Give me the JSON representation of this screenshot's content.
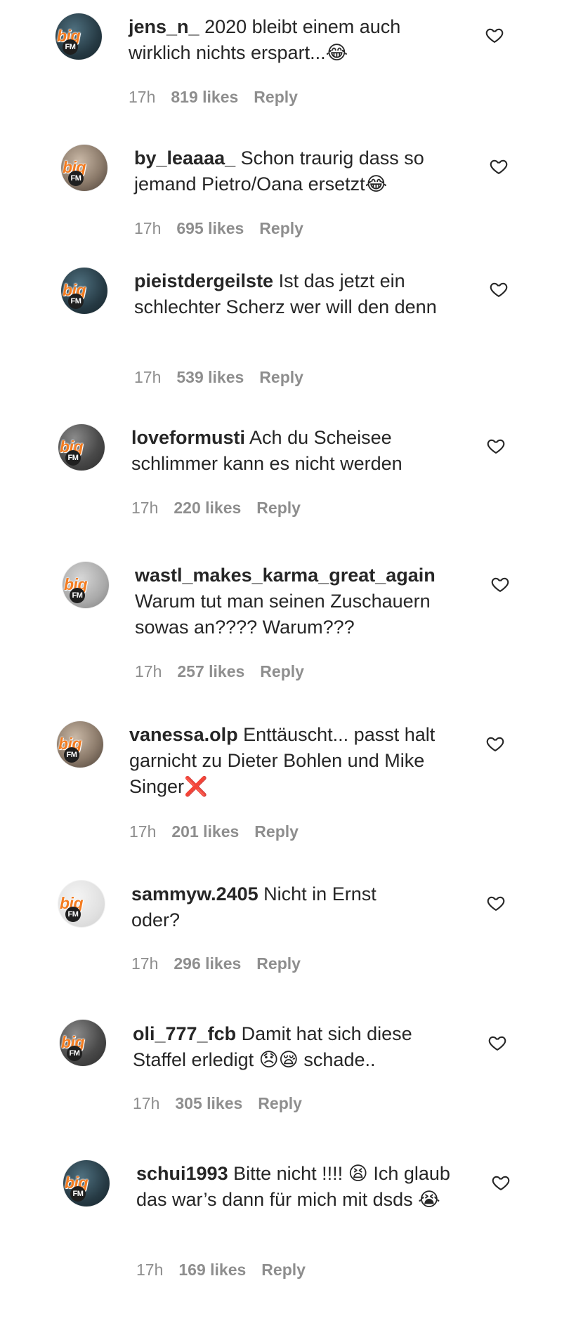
{
  "comments": [
    {
      "username": "jens_n_",
      "text": "2020 bleibt einem auch wirklich nichts erspart...😂",
      "time": "17h",
      "likes": "819 likes",
      "reply": "Reply",
      "avatar_logo": "big",
      "avatar_badge": "FM"
    },
    {
      "username": "by_leaaaa_",
      "text": "Schon traurig dass so jemand Pietro/Oana ersetzt😂",
      "time": "17h",
      "likes": "695 likes",
      "reply": "Reply",
      "avatar_logo": "big",
      "avatar_badge": "FM"
    },
    {
      "username": "pieistdergeilste",
      "text": "Ist das jetzt ein schlechter Scherz wer will den denn",
      "time": "17h",
      "likes": "539 likes",
      "reply": "Reply",
      "avatar_logo": "big",
      "avatar_badge": "FM"
    },
    {
      "username": "loveformusti",
      "text": "Ach du Scheisee schlimmer kann es nicht werden",
      "time": "17h",
      "likes": "220 likes",
      "reply": "Reply",
      "avatar_logo": "big",
      "avatar_badge": "FM"
    },
    {
      "username": "wastl_makes_karma_great_again",
      "text": "Warum tut man seinen Zuschauern sowas an???? Warum???",
      "time": "17h",
      "likes": "257 likes",
      "reply": "Reply",
      "avatar_logo": "big",
      "avatar_badge": "FM"
    },
    {
      "username": "vanessa.olp",
      "text": "Enttäuscht... passt halt garnicht zu Dieter Bohlen und Mike Singer❌",
      "time": "17h",
      "likes": "201 likes",
      "reply": "Reply",
      "avatar_logo": "big",
      "avatar_badge": "FM"
    },
    {
      "username": "sammyw.2405",
      "text": "Nicht in Ernst oder?",
      "time": "17h",
      "likes": "296 likes",
      "reply": "Reply",
      "avatar_logo": "big",
      "avatar_badge": "FM"
    },
    {
      "username": "oli_777_fcb",
      "text": "Damit hat sich diese Staffel erledigt 😞😪 schade..",
      "time": "17h",
      "likes": "305 likes",
      "reply": "Reply",
      "avatar_logo": "big",
      "avatar_badge": "FM"
    },
    {
      "username": "schui1993",
      "text": "Bitte nicht !!!! 😫 Ich glaub das war’s dann für mich mit dsds 😭",
      "time": "17h",
      "likes": "169 likes",
      "reply": "Reply",
      "avatar_logo": "big",
      "avatar_badge": "FM"
    }
  ],
  "colors": {
    "text": "#262626",
    "meta": "#8e8e8e",
    "brand_orange": "#f47c20"
  },
  "icons": {
    "like": "heart-outline-icon"
  }
}
